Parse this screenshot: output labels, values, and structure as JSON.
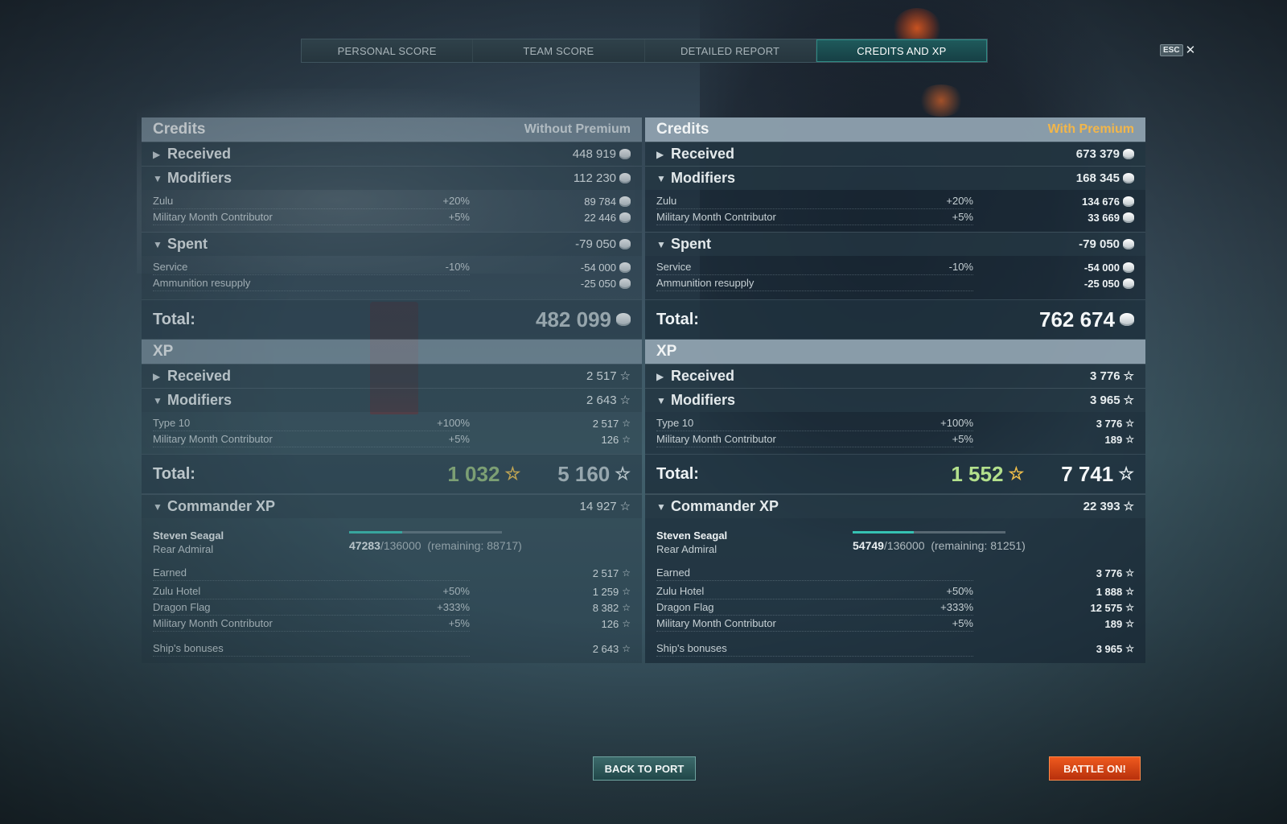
{
  "tabs": [
    "PERSONAL SCORE",
    "TEAM SCORE",
    "DETAILED REPORT",
    "CREDITS AND XP"
  ],
  "esc": {
    "key": "ESC",
    "close": "✕"
  },
  "left": {
    "credits_title": "Credits",
    "premium_label": "Without Premium",
    "received": {
      "label": "Received",
      "value": "448 919"
    },
    "modifiers": {
      "label": "Modifiers",
      "value": "112 230"
    },
    "modifier_rows": [
      {
        "label": "Zulu",
        "pct": "+20%",
        "value": "89 784"
      },
      {
        "label": "Military Month Contributor",
        "pct": "+5%",
        "value": "22 446"
      }
    ],
    "spent": {
      "label": "Spent",
      "value": "-79 050"
    },
    "spent_rows": [
      {
        "label": "Service",
        "pct": "-10%",
        "value": "-54 000"
      },
      {
        "label": "Ammunition resupply",
        "pct": "",
        "value": "-25 050"
      }
    ],
    "total_label": "Total:",
    "credits_total": "482 099",
    "xp_title": "XP",
    "xp_received": {
      "label": "Received",
      "value": "2 517"
    },
    "xp_modifiers": {
      "label": "Modifiers",
      "value": "2 643"
    },
    "xp_modifier_rows": [
      {
        "label": "Type 10",
        "pct": "+100%",
        "value": "2 517"
      },
      {
        "label": "Military Month Contributor",
        "pct": "+5%",
        "value": "126"
      }
    ],
    "xp_total_free": "1 032",
    "xp_total": "5 160",
    "commander": {
      "label": "Commander XP",
      "value": "14 927"
    },
    "commander_name": "Steven Seagal",
    "commander_rank": "Rear Admiral",
    "xp_current": "47283",
    "xp_max": "/136000",
    "xp_remaining": "(remaining: 88717)",
    "xp_progress": 0.3477,
    "cmd_rows": [
      {
        "label": "Earned",
        "pct": "",
        "value": "2 517"
      },
      {
        "label": "Zulu Hotel",
        "pct": "+50%",
        "value": "1 259"
      },
      {
        "label": "Dragon Flag",
        "pct": "+333%",
        "value": "8 382"
      },
      {
        "label": "Military Month Contributor",
        "pct": "+5%",
        "value": "126"
      }
    ],
    "ship_bonus": {
      "label": "Ship's bonuses",
      "value": "2 643"
    }
  },
  "right": {
    "credits_title": "Credits",
    "premium_label": "With Premium",
    "received": {
      "label": "Received",
      "value": "673 379"
    },
    "modifiers": {
      "label": "Modifiers",
      "value": "168 345"
    },
    "modifier_rows": [
      {
        "label": "Zulu",
        "pct": "+20%",
        "value": "134 676"
      },
      {
        "label": "Military Month Contributor",
        "pct": "+5%",
        "value": "33 669"
      }
    ],
    "spent": {
      "label": "Spent",
      "value": "-79 050"
    },
    "spent_rows": [
      {
        "label": "Service",
        "pct": "-10%",
        "value": "-54 000"
      },
      {
        "label": "Ammunition resupply",
        "pct": "",
        "value": "-25 050"
      }
    ],
    "total_label": "Total:",
    "credits_total": "762 674",
    "xp_title": "XP",
    "xp_received": {
      "label": "Received",
      "value": "3 776"
    },
    "xp_modifiers": {
      "label": "Modifiers",
      "value": "3 965"
    },
    "xp_modifier_rows": [
      {
        "label": "Type 10",
        "pct": "+100%",
        "value": "3 776"
      },
      {
        "label": "Military Month Contributor",
        "pct": "+5%",
        "value": "189"
      }
    ],
    "xp_total_free": "1 552",
    "xp_total": "7 741",
    "commander": {
      "label": "Commander XP",
      "value": "22 393"
    },
    "commander_name": "Steven Seagal",
    "commander_rank": "Rear Admiral",
    "xp_current": "54749",
    "xp_max": "/136000",
    "xp_remaining": "(remaining: 81251)",
    "xp_progress": 0.4026,
    "cmd_rows": [
      {
        "label": "Earned",
        "pct": "",
        "value": "3 776"
      },
      {
        "label": "Zulu Hotel",
        "pct": "+50%",
        "value": "1 888"
      },
      {
        "label": "Dragon Flag",
        "pct": "+333%",
        "value": "12 575"
      },
      {
        "label": "Military Month Contributor",
        "pct": "+5%",
        "value": "189"
      }
    ],
    "ship_bonus": {
      "label": "Ship's bonuses",
      "value": "3 965"
    }
  },
  "buttons": {
    "back": "BACK TO PORT",
    "battle": "BATTLE ON!"
  },
  "colors": {
    "accent": "#36c2b2",
    "premium_gold": "#f2b64a",
    "battle": "#e2471a",
    "free_xp": "#b3e08c"
  }
}
